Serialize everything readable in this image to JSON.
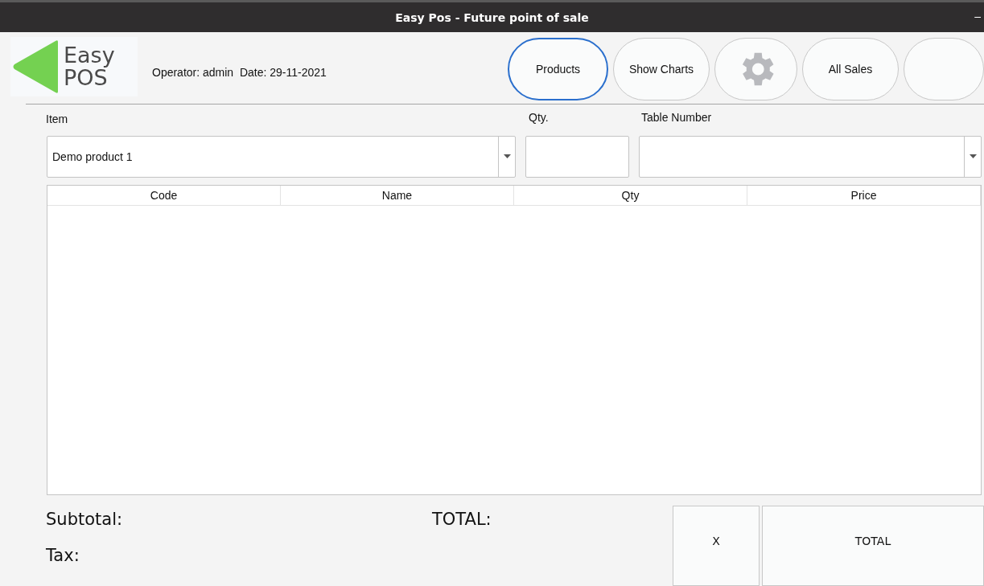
{
  "window": {
    "title": "Easy Pos - Future point of sale",
    "minimize": "–"
  },
  "logo": {
    "line1": "Easy",
    "line2": "POS"
  },
  "operator_info": "Operator: admin  Date: 29-11-2021",
  "toolbar": [
    {
      "kind": "text",
      "label": "Products",
      "selected": true
    },
    {
      "kind": "text",
      "label": "Show Charts",
      "selected": false
    },
    {
      "kind": "icon",
      "selected": false
    },
    {
      "kind": "text",
      "label": "All Sales",
      "selected": false
    },
    {
      "kind": "blank",
      "selected": false
    }
  ],
  "form": {
    "item_label": "Item",
    "item_value": "Demo product 1",
    "qty_label": "Qty.",
    "table_label": "Table Number"
  },
  "table": {
    "columns": [
      "Code",
      "Name",
      "Qty",
      "Price"
    ]
  },
  "summary": {
    "subtotal": "Subtotal:",
    "tax": "Tax:",
    "total": "TOTAL:"
  },
  "actions": [
    "X",
    "TOTAL"
  ]
}
